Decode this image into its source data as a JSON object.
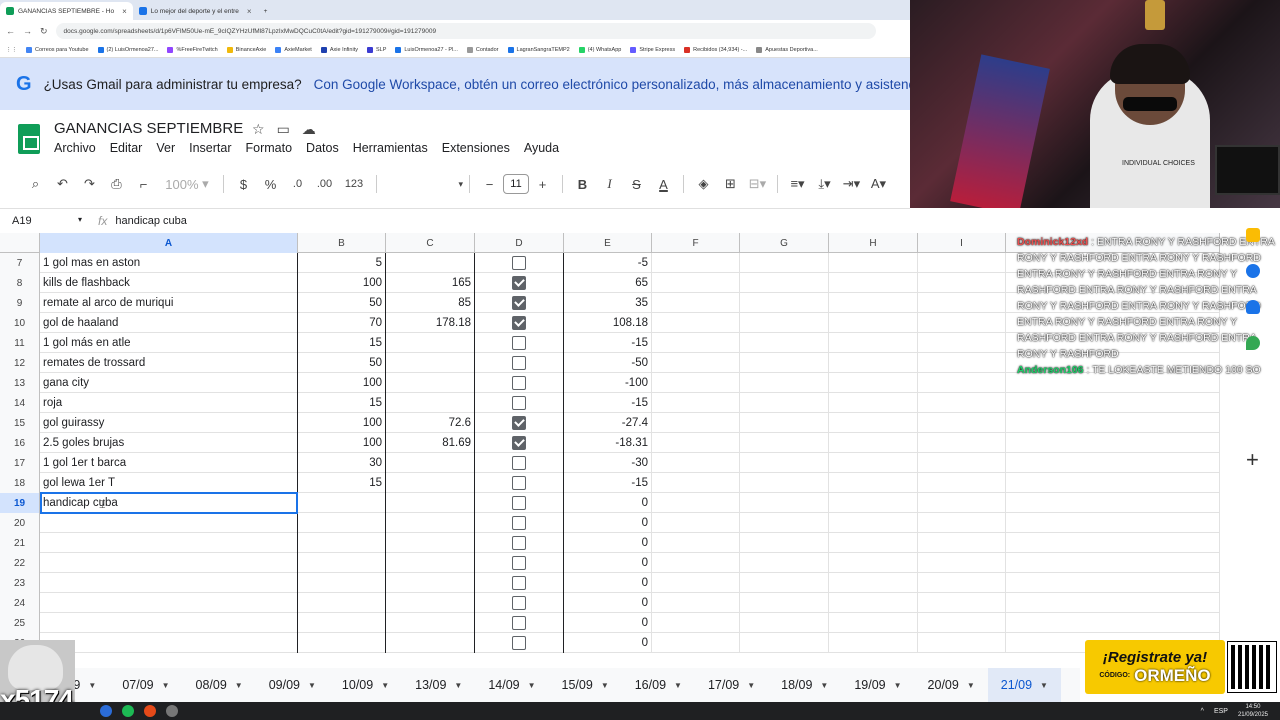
{
  "browser": {
    "tabs": [
      {
        "title": "GANANCIAS SEPTIEMBRE - Ho",
        "active": true,
        "color": "#0f9d58"
      },
      {
        "title": "Lo mejor del deporte y el entre",
        "active": false,
        "color": "#1a73e8"
      }
    ],
    "url": "docs.google.com/spreadsheets/d/1p6VFlM50Ue-mE_9cIQZYHzUfMl87LpzIxMwDQCuC0tA/edit?gid=191279009#gid=191279009",
    "bookmarks": [
      "Correos para Youtube",
      "(2) LuisOrmenoa27...",
      "%FreeFireTwitch",
      "BinanceAxie",
      "AxieMarket",
      "Axie Infinity",
      "SLP",
      "LuisOrmenoa27 - Pl...",
      "Contador",
      "LagranSangraTEMP2",
      "(4) WhatsApp",
      "Stripe Express",
      "Recibidos (34,934) -...",
      "Apuestas Deportiva..."
    ]
  },
  "banner": {
    "title": "¿Usas Gmail para administrar tu empresa?",
    "message": "Con Google Workspace, obtén un correo electrónico personalizado, más almacenamiento y asistencia las 24 ho"
  },
  "document": {
    "title": "GANANCIAS SEPTIEMBRE",
    "menu": [
      "Archivo",
      "Editar",
      "Ver",
      "Insertar",
      "Formato",
      "Datos",
      "Herramientas",
      "Extensiones",
      "Ayuda"
    ]
  },
  "toolbar": {
    "zoom": "100%",
    "currency": "$",
    "percent": "%",
    "dec_less": ".0",
    "dec_more": ".00",
    "number_format": "123",
    "font_size": "11"
  },
  "formula_bar": {
    "cell_ref": "A19",
    "fx": "fx",
    "content": "handicap cuba"
  },
  "grid": {
    "columns": [
      "A",
      "B",
      "C",
      "D",
      "E",
      "F",
      "G",
      "H",
      "I"
    ],
    "rows": [
      {
        "n": "7",
        "a": "1 gol mas en aston",
        "b": "5",
        "c": "",
        "checked": false,
        "e": "-5"
      },
      {
        "n": "8",
        "a": "kills de flashback",
        "b": "100",
        "c": "165",
        "checked": true,
        "e": "65"
      },
      {
        "n": "9",
        "a": "remate al arco de muriqui",
        "b": "50",
        "c": "85",
        "checked": true,
        "e": "35"
      },
      {
        "n": "10",
        "a": "gol de haaland",
        "b": "70",
        "c": "178.18",
        "checked": true,
        "e": "108.18"
      },
      {
        "n": "11",
        "a": "1 gol más en atle",
        "b": "15",
        "c": "",
        "checked": false,
        "e": "-15"
      },
      {
        "n": "12",
        "a": "remates de trossard",
        "b": "50",
        "c": "",
        "checked": false,
        "e": "-50"
      },
      {
        "n": "13",
        "a": "gana city",
        "b": "100",
        "c": "",
        "checked": false,
        "e": "-100"
      },
      {
        "n": "14",
        "a": "roja",
        "b": "15",
        "c": "",
        "checked": false,
        "e": "-15"
      },
      {
        "n": "15",
        "a": "gol guirassy",
        "b": "100",
        "c": "72.6",
        "checked": true,
        "e": "-27.4"
      },
      {
        "n": "16",
        "a": "2.5 goles brujas",
        "b": "100",
        "c": "81.69",
        "checked": true,
        "e": "-18.31"
      },
      {
        "n": "17",
        "a": "1 gol 1er t barca",
        "b": "30",
        "c": "",
        "checked": false,
        "e": "-30"
      },
      {
        "n": "18",
        "a": "gol lewa 1er T",
        "b": "15",
        "c": "",
        "checked": false,
        "e": "-15"
      },
      {
        "n": "19",
        "a": "handicap cuba",
        "b": "",
        "c": "",
        "checked": false,
        "e": "0"
      },
      {
        "n": "20",
        "a": "",
        "b": "",
        "c": "",
        "checked": false,
        "e": "0"
      },
      {
        "n": "21",
        "a": "",
        "b": "",
        "c": "",
        "checked": false,
        "e": "0"
      },
      {
        "n": "22",
        "a": "",
        "b": "",
        "c": "",
        "checked": false,
        "e": "0"
      },
      {
        "n": "23",
        "a": "",
        "b": "",
        "c": "",
        "checked": false,
        "e": "0"
      },
      {
        "n": "24",
        "a": "",
        "b": "",
        "c": "",
        "checked": false,
        "e": "0"
      },
      {
        "n": "25",
        "a": "",
        "b": "",
        "c": "",
        "checked": false,
        "e": "0"
      },
      {
        "n": "26",
        "a": "",
        "b": "",
        "c": "",
        "checked": false,
        "e": "0"
      }
    ],
    "selected_row": "19",
    "selected_col": "A"
  },
  "sheet_tabs": {
    "items": [
      "/09",
      "07/09",
      "08/09",
      "09/09",
      "10/09",
      "13/09",
      "14/09",
      "15/09",
      "16/09",
      "17/09",
      "18/09",
      "19/09",
      "20/09",
      "21/09"
    ],
    "active": "21/09"
  },
  "chat": [
    {
      "user": "Dominick12xd",
      "message": ": ENTRA RONY Y RASHFORD ENTRA RONY Y RASHFORD ENTRA RONY Y RASHFORD ENTRA RONY Y RASHFORD ENTRA RONY Y RASHFORD ENTRA RONY Y RASHFORD ENTRA RONY Y RASHFORD ENTRA RONY Y RASHFORD ENTRA RONY Y RASHFORD ENTRA RONY Y RASHFORD ENTRA RONY Y RASHFORD ENTRA RONY Y RASHFORD"
    },
    {
      "user": "Anderson106",
      "message": ": TE LOKEASTE METIENDO 100 SO"
    }
  ],
  "webcam": {
    "shirt_text": "INDIVIDUAL CHOICES"
  },
  "overlays": {
    "cat_label": "x5174",
    "promo_title": "¡Registrate ya!",
    "promo_code_label": "CÓDIGO:",
    "promo_code": "ORMEÑO"
  },
  "taskbar": {
    "lang": "ESP",
    "time": "14:50",
    "date": "21/09/2025"
  }
}
